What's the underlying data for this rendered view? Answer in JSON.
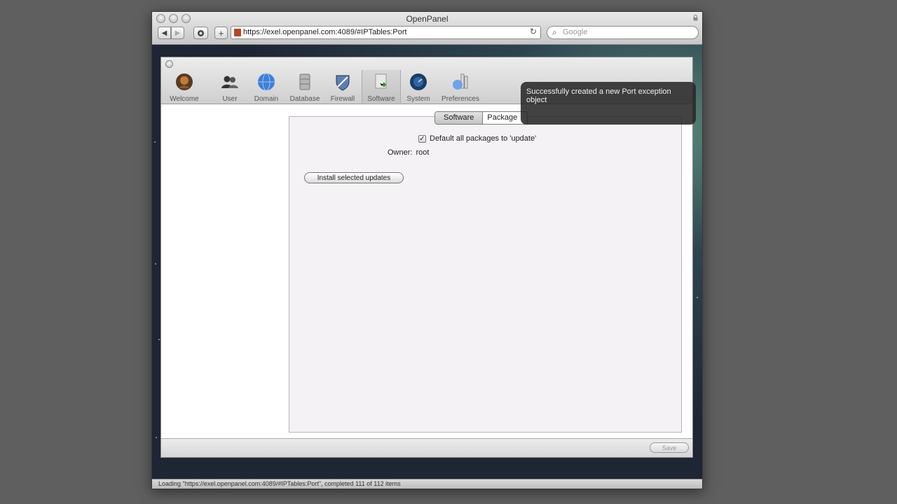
{
  "window": {
    "title": "OpenPanel"
  },
  "browser": {
    "back_label": "◀",
    "forward_label": "▶",
    "add_label": "+",
    "url": "https://exel.openpanel.com:4089/#IPTables:Port",
    "search_placeholder": "Google",
    "status": "Loading \"https://exel.openpanel.com:4089/#IPTables:Port\", completed 111 of 112 items"
  },
  "toolbar": {
    "items": [
      {
        "label": "Welcome",
        "icon": "welcome-icon"
      },
      {
        "label": "User",
        "icon": "users-icon"
      },
      {
        "label": "Domain",
        "icon": "globe-icon"
      },
      {
        "label": "Database",
        "icon": "database-icon"
      },
      {
        "label": "Firewall",
        "icon": "shield-icon"
      },
      {
        "label": "Software",
        "icon": "software-package-icon"
      },
      {
        "label": "System",
        "icon": "system-icon"
      },
      {
        "label": "Preferences",
        "icon": "preferences-icon"
      }
    ],
    "selected": "Software"
  },
  "notification": {
    "text": "Successfully created a new Port exception object"
  },
  "tabs": {
    "software": "Software",
    "package": "Package",
    "selected": "Software"
  },
  "form": {
    "checkbox_label": "Default all packages to 'update'",
    "checkbox_checked": true,
    "owner_label": "Owner:",
    "owner_value": "root",
    "install_button": "Install selected updates",
    "save_button": "Save"
  }
}
